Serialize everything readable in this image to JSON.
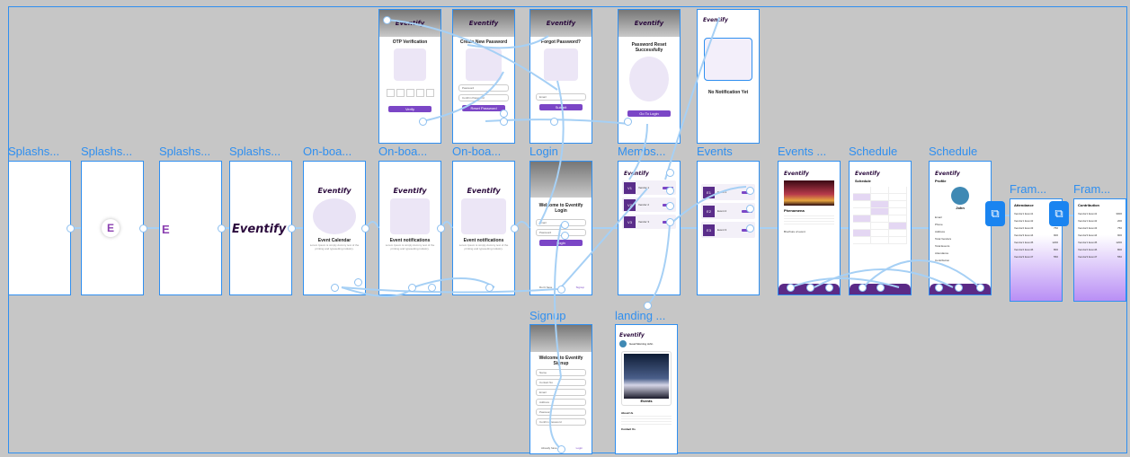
{
  "brand": {
    "name": "Eventify",
    "icon_letter": "E",
    "accent": "#2f8ff0",
    "primary": "#7b46c6"
  },
  "frames": {
    "splash1": "Splashs...",
    "splash2": "Splashs...",
    "splash3": "Splashs...",
    "splash4": "Splashs...",
    "onb1": "On-boa...",
    "onb2": "On-boa...",
    "onb3": "On-boa...",
    "login": "Login",
    "members": "Membs...",
    "events": "Events",
    "eventsd": "Events ...",
    "sched1": "Schedule",
    "sched2": "Schedule",
    "frame1": "Fram...",
    "frame2": "Fram...",
    "signup": "Signup",
    "landing": "landing ..."
  },
  "onboarding": [
    {
      "title": "Event Calendar",
      "text": "Lorem Ipsum is simply dummy text of the printing and typesetting industry."
    },
    {
      "title": "Event notifications",
      "text": "Lorem Ipsum is simply dummy text of the printing and typesetting industry."
    },
    {
      "title": "Event notifications",
      "text": "Lorem Ipsum is simply dummy text of the printing and typesetting industry."
    }
  ],
  "otp": {
    "title": "OTP Verification",
    "button": "Verify"
  },
  "newpw": {
    "title": "Create New Password",
    "field1": "Password",
    "field2": "Confirm Password",
    "button": "Reset Password"
  },
  "forgot": {
    "title": "Forgot Password?",
    "field": "Email",
    "button": "Submit"
  },
  "reset": {
    "title": "Password Reset Successfully",
    "button": "Go To Login"
  },
  "notif": {
    "title": "No Notification Yet"
  },
  "login": {
    "title": "Welcome to Eventify Login",
    "email": "Email",
    "password": "Password",
    "button": "Login",
    "signup_prompt": "Don't have",
    "signup_link": "Signup"
  },
  "members": [
    {
      "badge": "V1",
      "name": "Vendor 1"
    },
    {
      "badge": "V2",
      "name": "Vendor 2"
    },
    {
      "badge": "V3",
      "name": "Vendor 3"
    }
  ],
  "events": [
    {
      "badge": "E1",
      "name": "Event 1"
    },
    {
      "badge": "E2",
      "name": "Event 2"
    },
    {
      "badge": "E3",
      "name": "Event 3"
    }
  ],
  "event_detail": {
    "title": "Phenomena",
    "link": "Brochure of event"
  },
  "schedule": {
    "title": "Schedule"
  },
  "profile": {
    "title": "Profile",
    "name": "John",
    "fields": [
      "Email",
      "Phone",
      "Address",
      "Total Vendors",
      "Total Events",
      "Attendance",
      "Contribution"
    ]
  },
  "attendance": {
    "title": "Attendance",
    "rows": [
      [
        "Vendor1 Event1",
        "300"
      ],
      [
        "Vendor1 Event2",
        "200"
      ],
      [
        "Vendor2 Event3",
        "750"
      ],
      [
        "Vendor3 Event4",
        "900"
      ],
      [
        "Vendor1 Event5",
        "1200"
      ],
      [
        "Vendor2 Event6",
        "800"
      ],
      [
        "Vendor3 Event7",
        "550"
      ]
    ]
  },
  "contribution": {
    "title": "Contribution",
    "rows": [
      [
        "Vendor1 Event1",
        "3000"
      ],
      [
        "Vendor1 Event2",
        "200"
      ],
      [
        "Vendor2 Event3",
        "750"
      ],
      [
        "Vendor3 Event4",
        "900"
      ],
      [
        "Vendor1 Event5",
        "1200"
      ],
      [
        "Vendor2 Event6",
        "800"
      ],
      [
        "Vendor3 Event7",
        "550"
      ]
    ]
  },
  "signup": {
    "title": "Welcome to Eventify Signup",
    "fields": [
      "Name",
      "Contact No",
      "Email",
      "Address",
      "Password",
      "Confirm Password"
    ],
    "login_prompt": "Already have",
    "login_link": "Login"
  },
  "landing": {
    "user": "Good Morning John",
    "card_title": "Events",
    "about_title": "About Us",
    "contact_title": "Contact Us"
  }
}
